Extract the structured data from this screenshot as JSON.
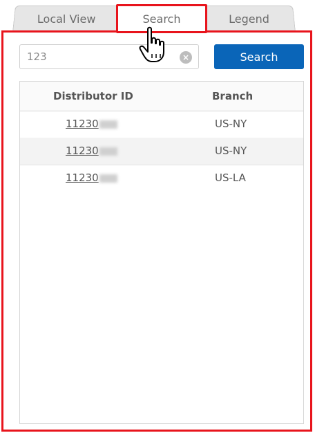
{
  "tabs": {
    "local_view": "Local View",
    "search": "Search",
    "legend": "Legend"
  },
  "search": {
    "value": "123",
    "button_label": "Search"
  },
  "table": {
    "headers": [
      "Distributor ID",
      "Branch"
    ],
    "rows": [
      {
        "id": "11230",
        "branch": "US-NY"
      },
      {
        "id": "11230",
        "branch": "US-NY"
      },
      {
        "id": "11230",
        "branch": "US-LA"
      }
    ]
  },
  "colors": {
    "highlight": "#e8141c",
    "search_button": "#0a65b8"
  },
  "icons": {
    "clear": "clear-icon",
    "cursor": "hand-pointer-icon"
  }
}
